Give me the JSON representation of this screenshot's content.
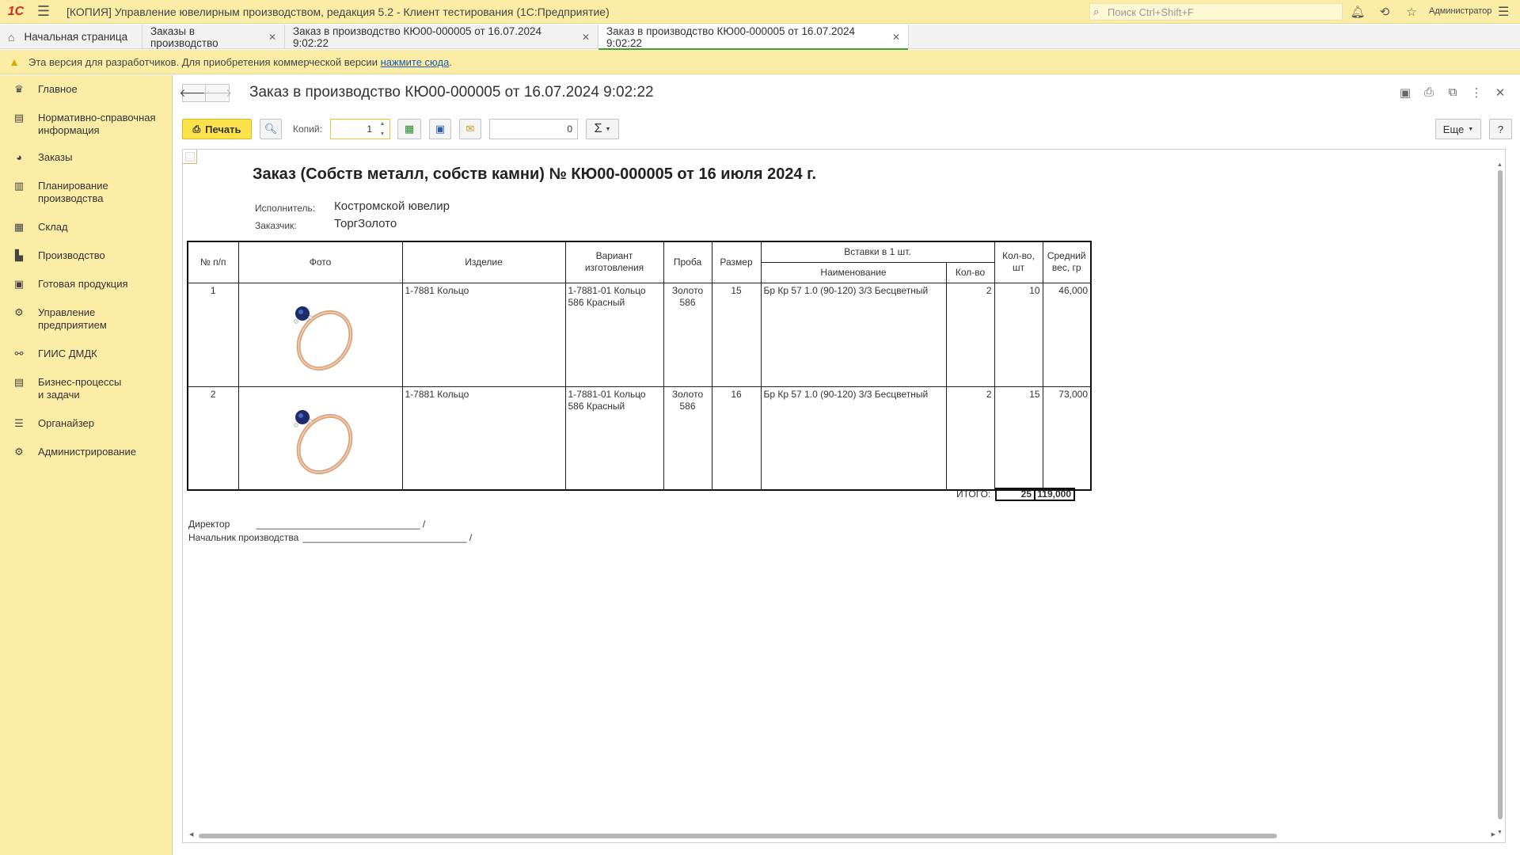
{
  "titlebar": {
    "logo": "1С",
    "app_title": "[КОПИЯ] Управление ювелирным производством, редакция 5.2  - Клиент тестирования (1С:Предприятие)",
    "search_placeholder": "Поиск Ctrl+Shift+F",
    "user": "Администратор",
    "icons": [
      "bell-icon",
      "history-icon",
      "star-icon",
      "menu-icon"
    ]
  },
  "tabs": [
    {
      "label": "Начальная страница",
      "icon": "home-icon",
      "closable": false,
      "active": false
    },
    {
      "label": "Заказы в производство",
      "closable": true,
      "active": false
    },
    {
      "label": "Заказ в производство КЮ00-000005 от 16.07.2024 9:02:22",
      "closable": true,
      "active": false
    },
    {
      "label": "Заказ в производство КЮ00-000005 от 16.07.2024 9:02:22",
      "closable": true,
      "active": true
    }
  ],
  "warning": {
    "text": "Эта версия для разработчиков. Для приобретения коммерческой версии",
    "link": "нажмите сюда",
    "tail": "."
  },
  "sidebar": {
    "items": [
      {
        "label": "Главное",
        "icon": "crown-icon"
      },
      {
        "label": "Нормативно-справочная информация",
        "icon": "book-icon"
      },
      {
        "label": "Заказы",
        "icon": "pie-chart-icon"
      },
      {
        "label": "Планирование производства",
        "icon": "clipboard-icon"
      },
      {
        "label": "Склад",
        "icon": "warehouse-icon"
      },
      {
        "label": "Производство",
        "icon": "factory-icon"
      },
      {
        "label": "Готовая продукция",
        "icon": "bag-icon"
      },
      {
        "label": "Управление предприятием",
        "icon": "management-icon"
      },
      {
        "label": "ГИИС ДМДК",
        "icon": "link-icon"
      },
      {
        "label": "Бизнес-процессы и задачи",
        "icon": "tasks-icon"
      },
      {
        "label": "Органайзер",
        "icon": "organizer-icon"
      },
      {
        "label": "Администрирование",
        "icon": "gear-icon"
      }
    ]
  },
  "document": {
    "title": "Заказ в производство КЮ00-000005 от 16.07.2024 9:02:22",
    "toolbar": {
      "print_label": "Печать",
      "copies_label": "Копий:",
      "copies_value": "1",
      "sum_value": "0",
      "sum_symbol": "Σ",
      "more_label": "Еще",
      "help_label": "?"
    }
  },
  "report": {
    "title": "Заказ (Собств металл, собств камни) № КЮ00-000005 от 16 июля 2024 г.",
    "executor_label": "Исполнитель:",
    "executor_value": "Костромской ювелир",
    "customer_label": "Заказчик:",
    "customer_value": "ТоргЗолото",
    "headers": {
      "num": "№ п/п",
      "photo": "Фото",
      "item": "Изделие",
      "variant": "Вариант изготовления",
      "probe": "Проба",
      "size": "Размер",
      "inserts": "Вставки в 1 шт.",
      "ins_name": "Наименование",
      "ins_qty": "Кол-во",
      "qty": "Кол-во, шт",
      "avg_weight": "Средний вес, гр"
    },
    "rows": [
      {
        "num": "1",
        "item": "1-7881 Кольцо",
        "variant": "1-7881-01 Кольцо 586 Красный",
        "probe": "Золото 586",
        "size": "15",
        "ins_name": "Бр Кр 57 1.0 (90-120) 3/3 Бесцветный",
        "ins_qty": "2",
        "qty": "10",
        "avg_weight": "46,000"
      },
      {
        "num": "2",
        "item": "1-7881 Кольцо",
        "variant": "1-7881-01 Кольцо 586 Красный",
        "probe": "Золото 586",
        "size": "16",
        "ins_name": "Бр Кр 57 1.0 (90-120) 3/3 Бесцветный",
        "ins_qty": "2",
        "qty": "15",
        "avg_weight": "73,000"
      }
    ],
    "total_label": "ИТОГО:",
    "total_qty": "25",
    "total_weight": "119,000",
    "sign_director": "Директор",
    "sign_chief": "Начальник производства",
    "sign_director_line": "_______________________________ /",
    "sign_chief_line": "_______________________________ /"
  },
  "colors": {
    "chrome": "#fbeda5",
    "print_button": "#fde24c",
    "active_tab_accent": "#3d9f3d",
    "brand": "#d52b1e"
  }
}
